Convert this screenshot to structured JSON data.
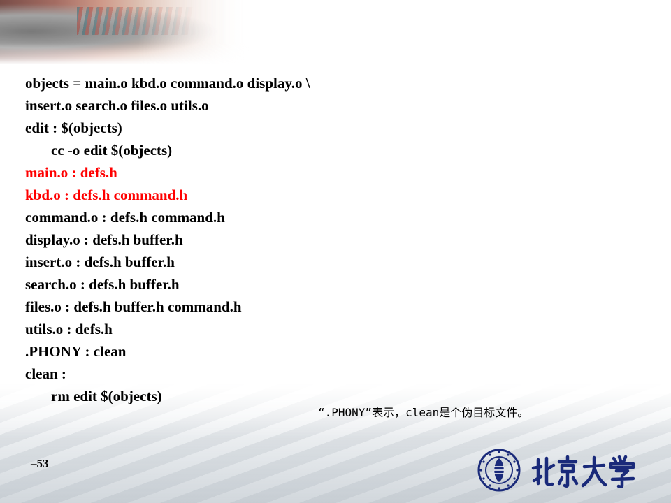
{
  "slide": {
    "code_lines": [
      {
        "text": "objects = main.o kbd.o command.o display.o \\",
        "indent": false,
        "color": "#000000"
      },
      {
        "text": "insert.o search.o files.o utils.o",
        "indent": false,
        "color": "#000000"
      },
      {
        "text": "edit : $(objects)",
        "indent": false,
        "color": "#000000"
      },
      {
        "text": "cc -o edit $(objects)",
        "indent": true,
        "color": "#000000"
      },
      {
        "text": "main.o : defs.h",
        "indent": false,
        "color": "#ff0000"
      },
      {
        "text": "kbd.o : defs.h command.h",
        "indent": false,
        "color": "#ff0000"
      },
      {
        "text": "command.o : defs.h command.h",
        "indent": false,
        "color": "#000000"
      },
      {
        "text": "display.o : defs.h buffer.h",
        "indent": false,
        "color": "#000000"
      },
      {
        "text": "insert.o : defs.h buffer.h",
        "indent": false,
        "color": "#000000"
      },
      {
        "text": "search.o : defs.h buffer.h",
        "indent": false,
        "color": "#000000"
      },
      {
        "text": "files.o : defs.h buffer.h command.h",
        "indent": false,
        "color": "#000000"
      },
      {
        "text": "utils.o : defs.h",
        "indent": false,
        "color": "#000000"
      },
      {
        "text": ".PHONY : clean",
        "indent": false,
        "color": "#000000"
      },
      {
        "text": "clean :",
        "indent": false,
        "color": "#000000"
      },
      {
        "text": "rm edit $(objects)",
        "indent": true,
        "color": "#000000"
      }
    ],
    "note": "“.PHONY”表示，clean是个伪目标文件。",
    "page_number": "–53",
    "logo": {
      "name": "peking-university-logo",
      "seal_text": "PEKING UNIVERSITY 1898",
      "wordmark": "北京大学"
    }
  }
}
